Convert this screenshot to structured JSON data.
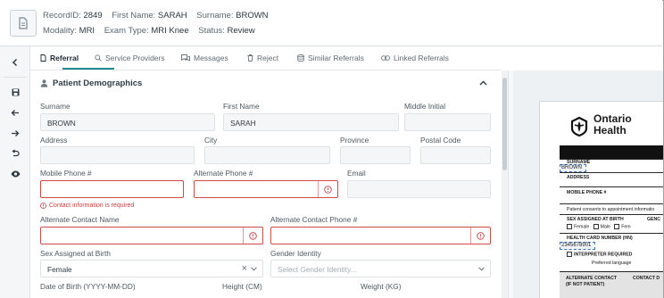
{
  "header": {
    "record_label": "RecordID:",
    "record_value": "2849",
    "first_label": "First Name:",
    "first_value": "SARAH",
    "surname_label": "Surname:",
    "surname_value": "BROWN",
    "modality_label": "Modality:",
    "modality_value": "MRI",
    "exam_label": "Exam Type:",
    "exam_value": "MRI Knee",
    "status_label": "Status:",
    "status_value": "Review"
  },
  "tabs": [
    {
      "label": "Referral",
      "icon": "document-icon",
      "active": true
    },
    {
      "label": "Service Providers",
      "icon": "search-icon"
    },
    {
      "label": "Messages",
      "icon": "chat-icon"
    },
    {
      "label": "Reject",
      "icon": "trash-icon"
    },
    {
      "label": "Similar Referrals",
      "icon": "database-icon"
    },
    {
      "label": "Linked Referrals",
      "icon": "link-icon"
    }
  ],
  "section": {
    "title": "Patient Demographics",
    "icon": "person-icon"
  },
  "form": {
    "surname": {
      "label": "Surname",
      "value": "BROWN"
    },
    "first_name": {
      "label": "First Name",
      "value": "SARAH"
    },
    "middle_initial": {
      "label": "Middle Initial",
      "value": ""
    },
    "address": {
      "label": "Address",
      "value": ""
    },
    "city": {
      "label": "City",
      "value": ""
    },
    "province": {
      "label": "Province",
      "value": ""
    },
    "postal_code": {
      "label": "Postal Code",
      "value": ""
    },
    "mobile_phone": {
      "label": "Mobile Phone #",
      "value": "",
      "error": "Contact information is required"
    },
    "alternate_phone": {
      "label": "Alternate Phone #",
      "value": ""
    },
    "email": {
      "label": "Email",
      "value": ""
    },
    "alt_contact_name": {
      "label": "Alternate Contact Name",
      "value": ""
    },
    "alt_contact_phone": {
      "label": "Alternate Contact Phone #",
      "value": ""
    },
    "sex": {
      "label": "Sex Assigned at Birth",
      "value": "Female"
    },
    "gender": {
      "label": "Gender Identity",
      "placeholder": "Select Gender Identity..."
    },
    "dob": {
      "label": "Date of Birth (YYYY-MM-DD)"
    },
    "height": {
      "label": "Height (CM)"
    },
    "weight": {
      "label": "Weight (KG)"
    }
  },
  "preview": {
    "logo_line1": "Ontario",
    "logo_line2": "Health",
    "surname_label": "SURNAME",
    "surname_value": "BROWN",
    "address_label": "ADDRESS",
    "mobile_label": "MOBILE PHONE #",
    "consent_text": "Patient consents to appointment informatio",
    "sex_label": "SEX ASSIGNED AT BIRTH",
    "gender_label": "GENC",
    "female_opt": "Female",
    "male_opt": "Male",
    "fem_opt2": "Fem",
    "hcn_label": "HEALTH CARD NUMBER (HN)",
    "hcn_value": "2345678901",
    "interpreter_label": "INTERPRETER REQUIRED",
    "pref_lang": "Preferred language",
    "alt_contact_label": "ALTERNATE CONTACT",
    "alt_contact_sub": "(IF NOT PATIENT)",
    "contact_label": "CONTACT D"
  }
}
